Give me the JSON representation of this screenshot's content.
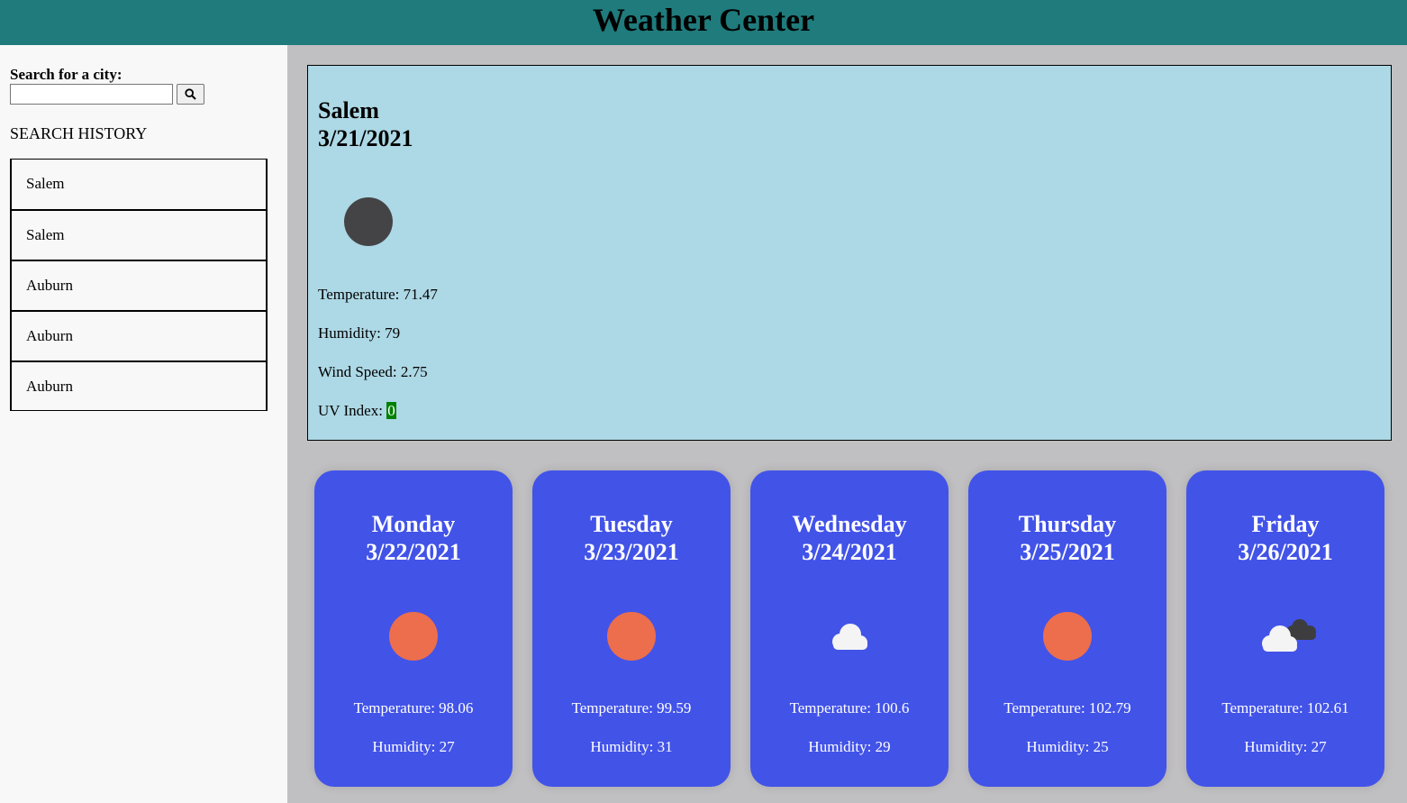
{
  "header": {
    "title": "Weather Center"
  },
  "search": {
    "label": "Search for a city:",
    "value": "",
    "placeholder": ""
  },
  "history": {
    "title": "SEARCH HISTORY",
    "items": [
      "Salem",
      "Salem",
      "Auburn",
      "Auburn",
      "Auburn"
    ]
  },
  "current": {
    "city": "Salem",
    "date": "3/21/2021",
    "icon": "moon-icon",
    "temperature": "Temperature: 71.47",
    "humidity": "Humidity: 79",
    "wind": "Wind Speed: 2.75",
    "uv_label": "UV Index: ",
    "uv_value": "0",
    "uv_color": "#008000"
  },
  "forecast": [
    {
      "day": "Monday",
      "date": "3/22/2021",
      "icon": "sun-icon",
      "temp": "Temperature: 98.06",
      "humidity": "Humidity: 27"
    },
    {
      "day": "Tuesday",
      "date": "3/23/2021",
      "icon": "sun-icon",
      "temp": "Temperature: 99.59",
      "humidity": "Humidity: 31"
    },
    {
      "day": "Wednesday",
      "date": "3/24/2021",
      "icon": "cloud-icon",
      "temp": "Temperature: 100.6",
      "humidity": "Humidity: 29"
    },
    {
      "day": "Thursday",
      "date": "3/25/2021",
      "icon": "sun-icon",
      "temp": "Temperature: 102.79",
      "humidity": "Humidity: 25"
    },
    {
      "day": "Friday",
      "date": "3/26/2021",
      "icon": "broken-clouds-icon",
      "temp": "Temperature: 102.61",
      "humidity": "Humidity: 27"
    }
  ],
  "colors": {
    "header": "#1f7b7c",
    "current_panel": "#add8e5",
    "card": "#4253e8",
    "sun": "#ec6e4c",
    "moon": "#444446"
  }
}
